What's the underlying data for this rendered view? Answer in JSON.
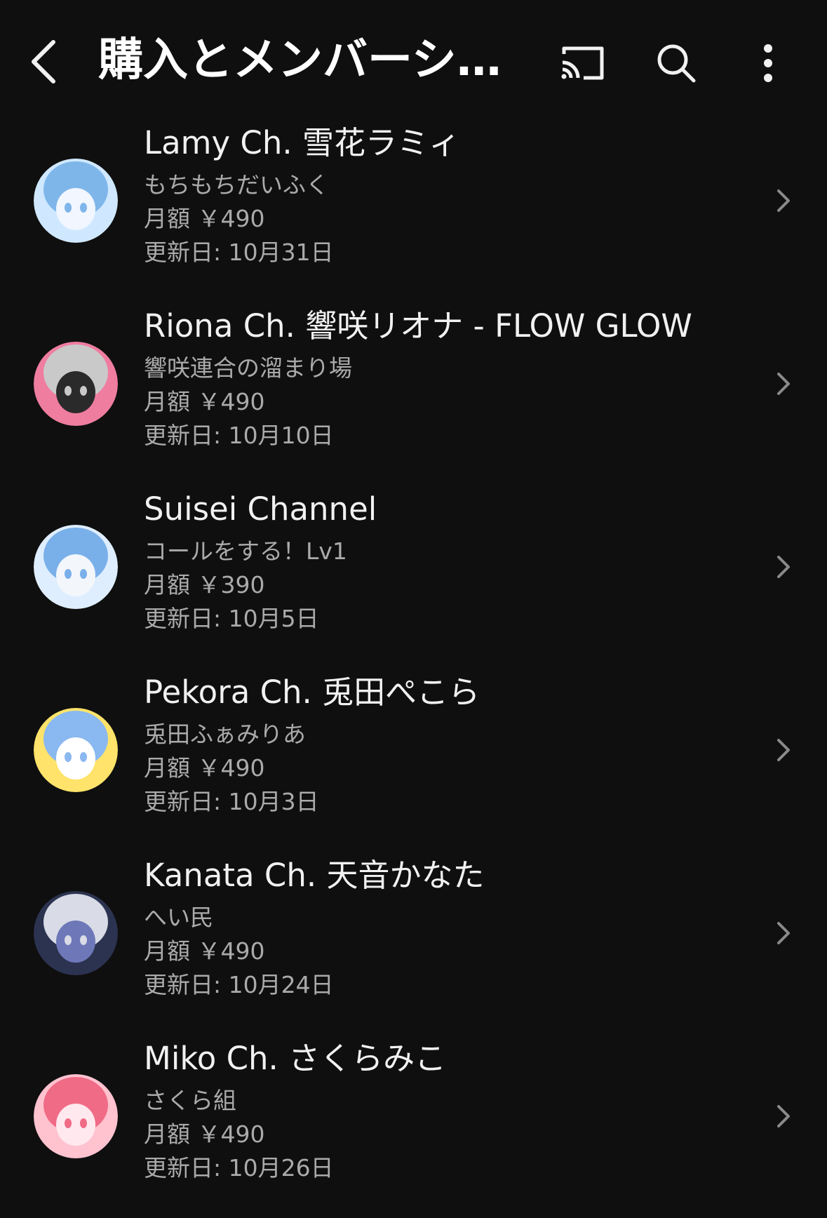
{
  "header": {
    "title": "購入とメンバーシ…",
    "icons": [
      "back-icon",
      "cast-icon",
      "search-icon",
      "more-vert-icon"
    ]
  },
  "memberships": [
    {
      "channel": "Lamy Ch. 雪花ラミィ",
      "tier": "もちもちだいふく",
      "price": "月額 ￥490",
      "renewal": "更新日: 10月31日",
      "avatar_colors": [
        "#cfe8ff",
        "#7fb6ea",
        "#f1f6ff"
      ]
    },
    {
      "channel": "Riona Ch. 響咲リオナ - FLOW GLOW",
      "tier": "響咲連合の溜まり場",
      "price": "月額 ￥490",
      "renewal": "更新日: 10月10日",
      "avatar_colors": [
        "#ef7da0",
        "#c9c9c9",
        "#2a2a2a"
      ]
    },
    {
      "channel": "Suisei Channel",
      "tier": "コールをする！Lv1",
      "price": "月額 ￥390",
      "renewal": "更新日: 10月5日",
      "avatar_colors": [
        "#dfeeff",
        "#7ab0ea",
        "#f3f6fb"
      ]
    },
    {
      "channel": "Pekora Ch. 兎田ぺこら",
      "tier": "兎田ふぁみりあ",
      "price": "月額 ￥490",
      "renewal": "更新日: 10月3日",
      "avatar_colors": [
        "#ffe36a",
        "#8ab8f0",
        "#ffffff"
      ]
    },
    {
      "channel": "Kanata Ch. 天音かなた",
      "tier": "へい民",
      "price": "月額 ￥490",
      "renewal": "更新日: 10月24日",
      "avatar_colors": [
        "#2b3350",
        "#d9dbe6",
        "#6e78b8"
      ]
    },
    {
      "channel": "Miko Ch. さくらみこ",
      "tier": "さくら組",
      "price": "月額 ￥490",
      "renewal": "更新日: 10月26日",
      "avatar_colors": [
        "#ffc2cf",
        "#f06b86",
        "#ffe9ee"
      ]
    }
  ],
  "colors": {
    "background": "#0f0f0f",
    "primary_text": "#f1f1f1",
    "secondary_text": "#aaaaaa",
    "chevron": "#8a8a8a"
  }
}
